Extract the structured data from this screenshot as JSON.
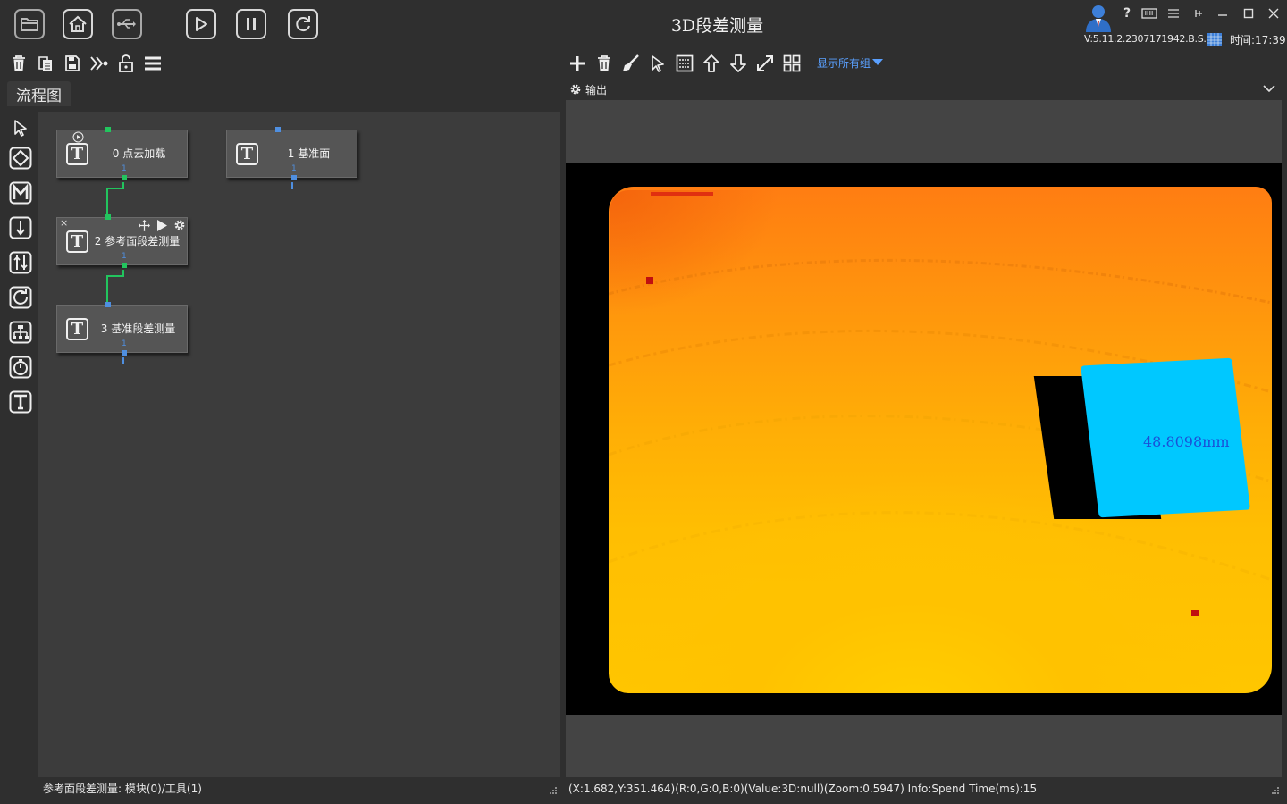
{
  "app": {
    "title": "3D段差测量",
    "version": "V:5.11.2.2307171942.B.S.C",
    "clock": "时间:17:39"
  },
  "titlebar": {
    "icons": [
      "folder-open-icon",
      "home-icon",
      "usb-icon",
      "play-icon",
      "pause-icon",
      "refresh-icon"
    ],
    "help_label": "?"
  },
  "left": {
    "tab_label": "流程图",
    "toolbar_icons": [
      "trash-icon",
      "copy-icon",
      "save-icon",
      "link-icon",
      "unlock-icon",
      "menu-icon"
    ],
    "palette_icons": [
      "pointer-icon",
      "diamond-icon",
      "m-module-icon",
      "down-arrow-icon",
      "sliders-icon",
      "loop-icon",
      "hierarchy-icon",
      "timer-icon",
      "text-tool-icon"
    ],
    "nodes": [
      {
        "label": "0 点云加载",
        "port_num": "1"
      },
      {
        "label": "1 基准面",
        "port_num": "1"
      },
      {
        "label": "2 参考面段差测量",
        "port_num": "1"
      },
      {
        "label": "3 基准段差测量",
        "port_num": "1"
      }
    ],
    "node_close": "×",
    "status": "参考面段差测量: 模块(0)/工具(1)"
  },
  "right": {
    "toolbar_icons": [
      "add-icon",
      "delete-icon",
      "brush-icon",
      "select-icon",
      "grid-view-icon",
      "move-up-icon",
      "move-down-icon",
      "expand-icon",
      "tile-icon"
    ],
    "show_groups_label": "显示所有组",
    "output_label": "输出",
    "measurement": "48.8098mm",
    "status": "(X:1.682,Y:351.464)(R:0,G:0,B:0)(Value:3D:null)(Zoom:0.5947)   Info:Spend Time(ms):15"
  },
  "colors": {
    "background": "#2f2f2f",
    "canvas": "#3c3c3c",
    "node": "#555555",
    "connector_green": "#22c55e",
    "port_blue": "#4f8fe0",
    "link_blue": "#5aa0ff",
    "heightmap_high": "#ff7a10",
    "heightmap_low": "#ffcc00",
    "step_region": "#00c8ff"
  }
}
